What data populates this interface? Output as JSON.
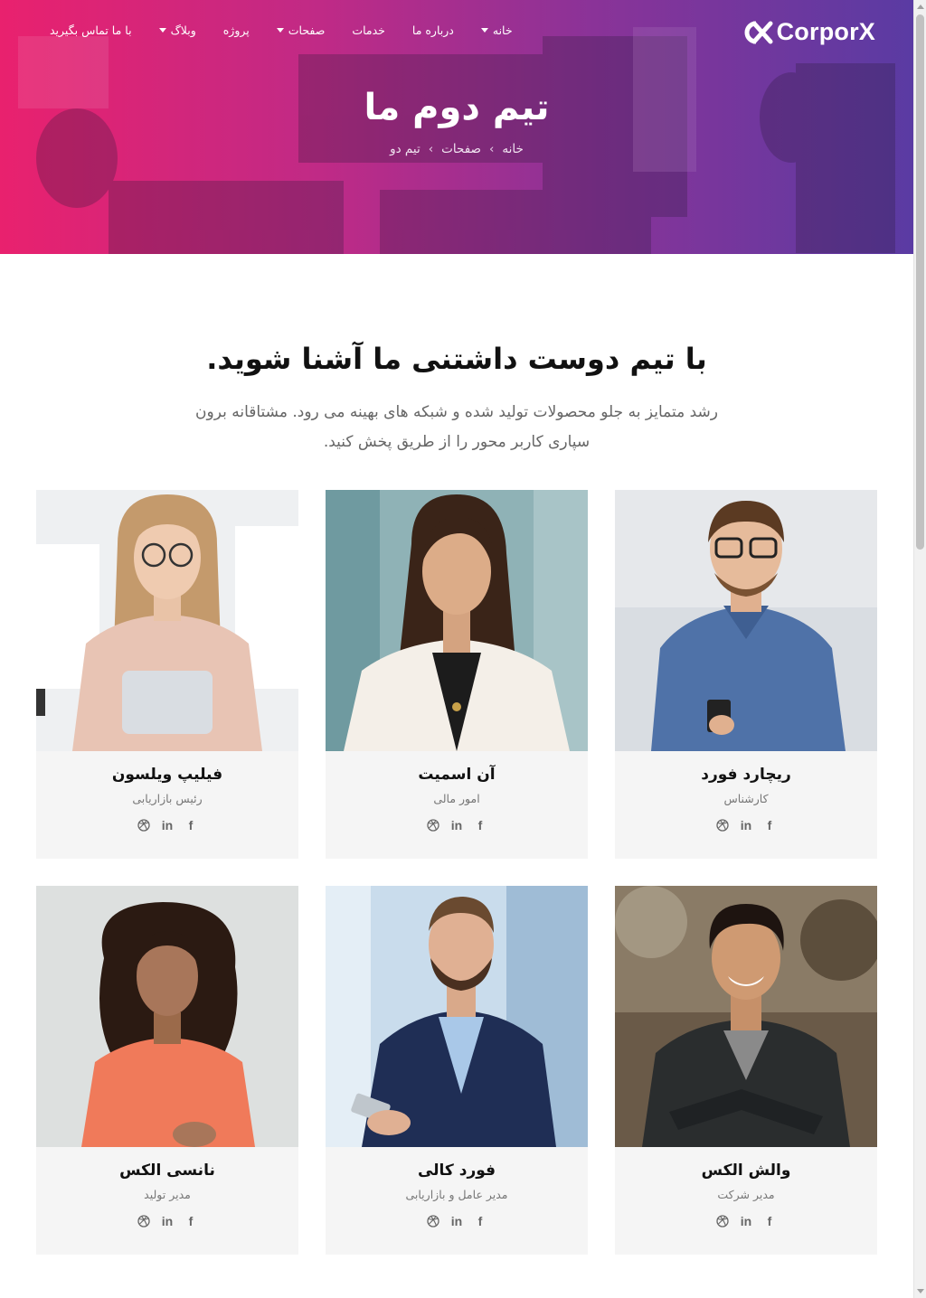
{
  "brand": {
    "name": "CorporX"
  },
  "nav": [
    {
      "label": "با ما تماس بگیرید",
      "dropdown": false
    },
    {
      "label": "وبلاگ",
      "dropdown": true
    },
    {
      "label": "پروژه",
      "dropdown": false
    },
    {
      "label": "صفحات",
      "dropdown": true
    },
    {
      "label": "خدمات",
      "dropdown": false
    },
    {
      "label": "درباره ما",
      "dropdown": false
    },
    {
      "label": "خانه",
      "dropdown": true
    }
  ],
  "hero": {
    "title": "تیم دوم ما",
    "breadcrumb": [
      "خانه",
      "صفحات",
      "تیم دو"
    ]
  },
  "section": {
    "title": "با تیم دوست داشتنی ما آشنا شوید.",
    "subtitle_line1": "رشد متمایز به جلو محصولات تولید شده و شبکه های بهینه می رود. مشتاقانه برون",
    "subtitle_line2": "سپاری کاربر محور را از طریق پخش کنید."
  },
  "team": [
    {
      "name": "ریچارد فورد",
      "role": "کارشناس"
    },
    {
      "name": "آن اسمیت",
      "role": "امور مالی"
    },
    {
      "name": "فیلیپ ویلسون",
      "role": "رئیس بازاریابی"
    },
    {
      "name": "والش الکس",
      "role": "مدیر شرکت"
    },
    {
      "name": "فورد کالی",
      "role": "مدیر عامل و بازاریابی"
    },
    {
      "name": "نانسی الکس",
      "role": "مدیر تولید"
    }
  ],
  "social": {
    "facebook": "f",
    "linkedin": "in"
  },
  "icons": {
    "facebook": "facebook-icon",
    "linkedin": "linkedin-icon",
    "dribbble": "dribbble-icon",
    "dropdown": "chevron-down-icon"
  },
  "colors": {
    "hero_start": "#e9216e",
    "hero_end": "#5a3ba3",
    "card_bg": "#f5f5f5"
  }
}
